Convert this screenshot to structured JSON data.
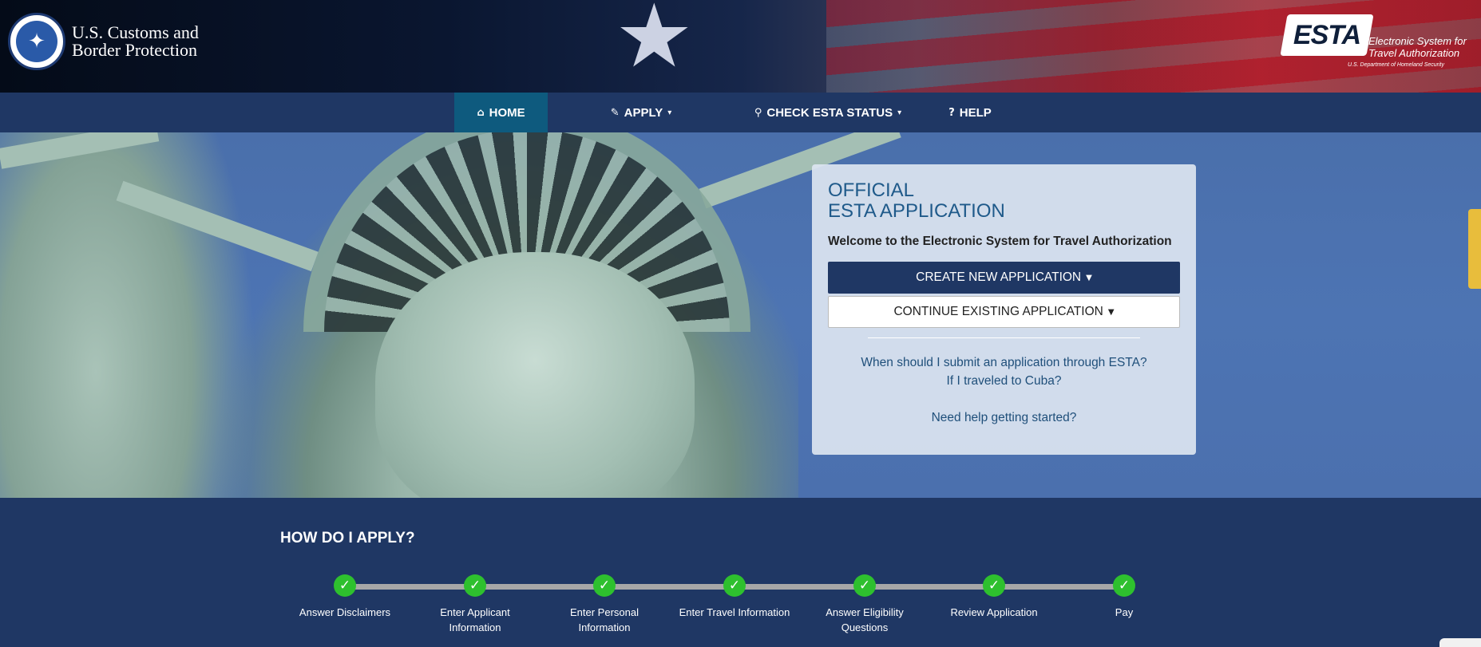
{
  "header": {
    "agency_line1": "U.S. Customs and",
    "agency_line2": "Border Protection",
    "logo_text": "ESTA",
    "logo_sub1": "Electronic System for",
    "logo_sub2": "Travel Authorization",
    "logo_dept": "U.S. Department of Homeland Security"
  },
  "nav": {
    "home": "HOME",
    "apply": "APPLY",
    "check_status": "CHECK ESTA STATUS",
    "help": "HELP"
  },
  "panel": {
    "title_line1": "OFFICIAL",
    "title_line2": "ESTA APPLICATION",
    "welcome": "Welcome to the Electronic System for Travel Authorization",
    "create_button": "CREATE NEW APPLICATION",
    "continue_button": "CONTINUE EXISTING APPLICATION",
    "link_when": "When should I submit an application through ESTA?",
    "link_cuba": "If I traveled to Cuba?",
    "link_help": "Need help getting started?"
  },
  "apply": {
    "title": "HOW DO I APPLY?",
    "steps": [
      {
        "line1": "Answer Disclaimers",
        "line2": ""
      },
      {
        "line1": "Enter Applicant",
        "line2": "Information"
      },
      {
        "line1": "Enter Personal",
        "line2": "Information"
      },
      {
        "line1": "Enter Travel Information",
        "line2": ""
      },
      {
        "line1": "Answer Eligibility",
        "line2": "Questions"
      },
      {
        "line1": "Review Application",
        "line2": ""
      },
      {
        "line1": "Pay",
        "line2": ""
      }
    ]
  },
  "icons": {
    "home": "home-icon",
    "apply": "pencil-icon",
    "check": "search-icon",
    "help": "question-circle-icon",
    "step_done": "check-icon"
  },
  "colors": {
    "nav_bg": "#1f3764",
    "nav_active": "#0e5a7e",
    "primary_button": "#1f3764",
    "step_complete": "#2ec02e",
    "link": "#1f4f7a"
  }
}
